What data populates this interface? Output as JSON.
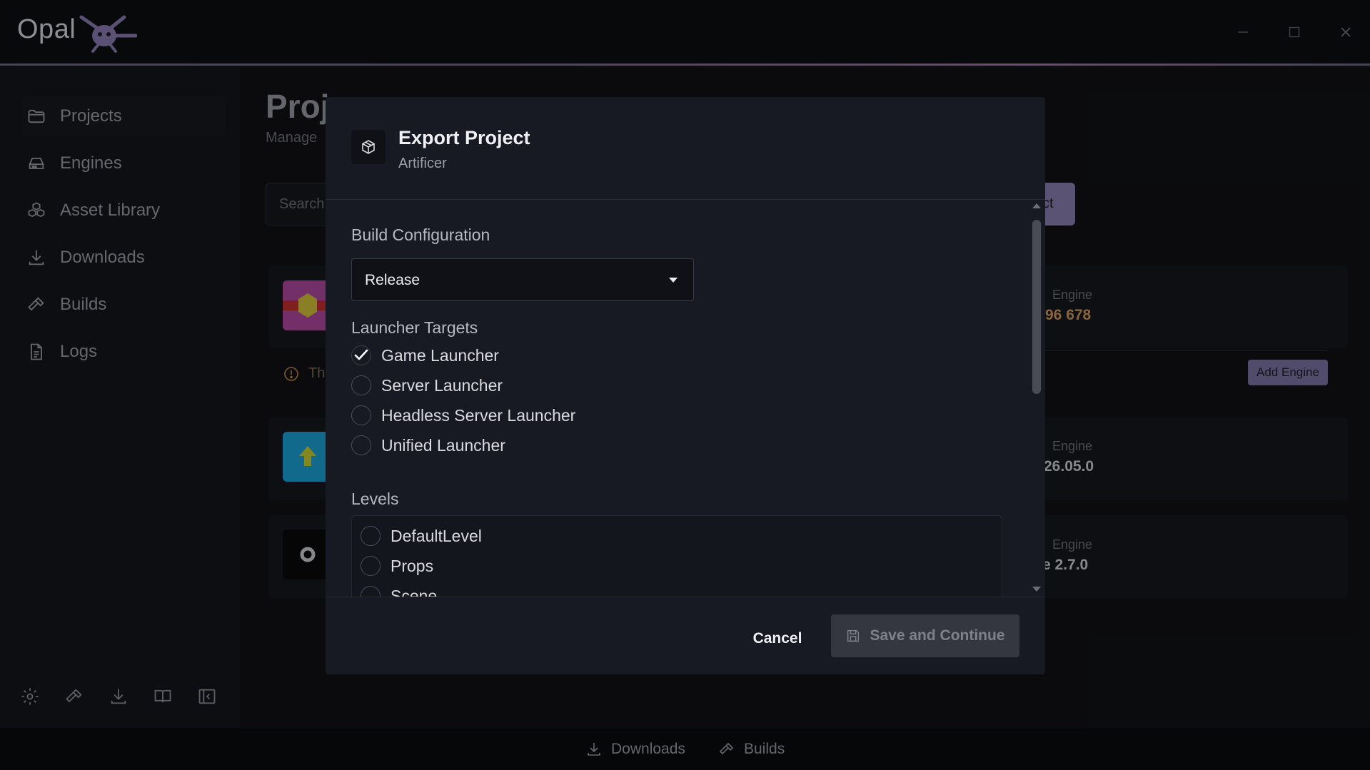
{
  "app": {
    "name": "Opal"
  },
  "sidebar": {
    "items": [
      {
        "label": "Projects",
        "icon": "folder-icon"
      },
      {
        "label": "Engines",
        "icon": "drive-icon"
      },
      {
        "label": "Asset Library",
        "icon": "boxes-icon"
      },
      {
        "label": "Downloads",
        "icon": "download-icon"
      },
      {
        "label": "Builds",
        "icon": "hammer-icon"
      },
      {
        "label": "Logs",
        "icon": "file-text-icon"
      }
    ],
    "tools": [
      "gear-icon",
      "hammer-icon",
      "download-icon",
      "book-icon",
      "collapse-sidebar-icon"
    ]
  },
  "main": {
    "title": "Proj",
    "subtitle": "Manage",
    "search_placeholder": "Search",
    "new_button_fragment": "ct",
    "warning_fragment": "Th",
    "add_engine_label": "Add Engine",
    "projects": [
      {
        "engine_label": "Engine",
        "engine_value": "96 678",
        "value_color": "#d59a5c",
        "thumb_color": "#b14aa0"
      },
      {
        "engine_label": "Engine",
        "engine_value": "26.05.0",
        "value_color": "#cfd1d6",
        "thumb_color": "#1ba1d8"
      },
      {
        "engine_label": "Engine",
        "engine_value": "e 2.7.0",
        "value_color": "#cfd1d6",
        "thumb_color": "#0a0a0c"
      }
    ]
  },
  "bottombar": {
    "downloads_label": "Downloads",
    "builds_label": "Builds"
  },
  "modal": {
    "title": "Export Project",
    "subtitle": "Artificer",
    "build_config": {
      "label": "Build Configuration",
      "selected": "Release"
    },
    "launcher_targets": {
      "label": "Launcher Targets",
      "options": [
        {
          "label": "Game Launcher",
          "checked": true
        },
        {
          "label": "Server Launcher",
          "checked": false
        },
        {
          "label": "Headless Server Launcher",
          "checked": false
        },
        {
          "label": "Unified Launcher",
          "checked": false
        }
      ]
    },
    "levels": {
      "label": "Levels",
      "options": [
        {
          "label": "DefaultLevel",
          "checked": false
        },
        {
          "label": "Props",
          "checked": false
        },
        {
          "label": "Scene",
          "checked": false
        }
      ]
    },
    "cancel_label": "Cancel",
    "save_label": "Save and Continue"
  }
}
